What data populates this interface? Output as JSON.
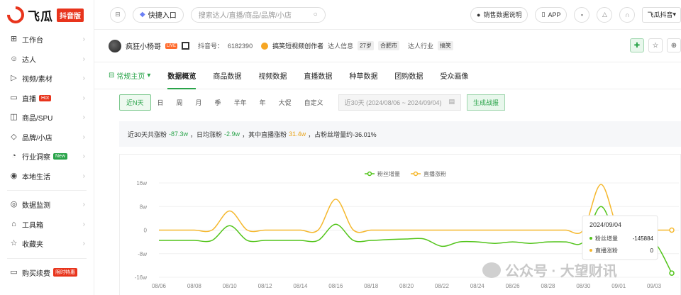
{
  "brand": {
    "name": "飞瓜",
    "badge": "抖音版"
  },
  "sidebar": {
    "items": [
      {
        "icon": "dashboard-icon",
        "glyph": "⊞",
        "label": "工作台"
      },
      {
        "icon": "user-icon",
        "glyph": "☺",
        "label": "达人"
      },
      {
        "icon": "play-icon",
        "glyph": "▷",
        "label": "视频/素材"
      },
      {
        "icon": "live-icon",
        "glyph": "▭",
        "label": "直播",
        "tag": "Hot",
        "tag_color": "#e8341c"
      },
      {
        "icon": "bag-icon",
        "glyph": "◫",
        "label": "商品/SPU"
      },
      {
        "icon": "tag-icon",
        "glyph": "◇",
        "label": "品牌/小店"
      },
      {
        "icon": "industry-icon",
        "glyph": "◔",
        "label": "行业洞察",
        "tag": "New",
        "tag_color": "#2aa44a"
      },
      {
        "icon": "location-icon",
        "glyph": "◉",
        "label": "本地生活"
      }
    ],
    "items2": [
      {
        "icon": "monitor-icon",
        "glyph": "◎",
        "label": "数据监测"
      },
      {
        "icon": "toolbox-icon",
        "glyph": "⌂",
        "label": "工具箱"
      },
      {
        "icon": "star-icon",
        "glyph": "☆",
        "label": "收藏夹"
      }
    ],
    "bottom": {
      "label": "购买续费",
      "tag": "限时特惠"
    }
  },
  "topbar": {
    "quick_entry": "快捷入口",
    "search_placeholder": "搜索达人/直播/商品/品牌/小店",
    "sales_note": "销售数据说明",
    "app": "APP",
    "user": "飞瓜抖音"
  },
  "profile": {
    "name": "疯狂小杨哥",
    "live_tag": "LIVE",
    "douyin_id_label": "抖音号：",
    "douyin_id": "6182390",
    "creator_label": "搞笑短视频创作者",
    "info_label": "达人信息",
    "age": "27岁",
    "city": "合肥市",
    "industry_label": "达人行业",
    "industry": "搞笑"
  },
  "tabs": [
    {
      "label": "常规主页",
      "first": true
    },
    {
      "label": "数据概览",
      "active": true
    },
    {
      "label": "商品数据"
    },
    {
      "label": "视频数据"
    },
    {
      "label": "直播数据"
    },
    {
      "label": "种草数据"
    },
    {
      "label": "团购数据"
    },
    {
      "label": "受众画像"
    }
  ],
  "filters": {
    "options": [
      "近N天",
      "日",
      "周",
      "月",
      "季",
      "半年",
      "年",
      "大促",
      "自定义"
    ],
    "active_index": 0,
    "date_range": "近30天 (2024/08/06 ~ 2024/09/04)",
    "generate": "生成战报"
  },
  "summary": {
    "t1": "近30天共涨粉",
    "v1": "-87.3w",
    "t2": "，日均涨粉",
    "v2": "-2.9w",
    "t3": "，其中直播涨粉",
    "v3": "31.4w",
    "t4": "，占粉丝增量约-36.01%"
  },
  "chart_data": {
    "type": "line",
    "x": [
      "08/06",
      "08/07",
      "08/08",
      "08/09",
      "08/10",
      "08/11",
      "08/12",
      "08/13",
      "08/14",
      "08/15",
      "08/16",
      "08/17",
      "08/18",
      "08/19",
      "08/20",
      "08/21",
      "08/22",
      "08/23",
      "08/24",
      "08/25",
      "08/26",
      "08/27",
      "08/28",
      "08/29",
      "08/30",
      "08/31",
      "09/01",
      "09/02",
      "09/03",
      "09/04"
    ],
    "tick_labels": [
      "08/06",
      "08/08",
      "08/10",
      "08/12",
      "08/14",
      "08/16",
      "08/18",
      "08/20",
      "08/22",
      "08/24",
      "08/26",
      "08/28",
      "08/30",
      "09/01",
      "09/03"
    ],
    "yticks": [
      "16w",
      "8w",
      "0",
      "-8w",
      "-16w"
    ],
    "ylim": [
      -16,
      16
    ],
    "series": [
      {
        "name": "粉丝增量",
        "color": "#52c41a",
        "values": [
          -3.5,
          -3.5,
          -3.5,
          -3.5,
          1.5,
          -3.5,
          -3.5,
          -3.5,
          -3.5,
          -3.5,
          2,
          -3.5,
          -3.5,
          -3.2,
          -3,
          -3,
          -5.5,
          -4,
          -4,
          -4.5,
          -4,
          -4.5,
          -4,
          -4,
          -4,
          8,
          -4,
          -4,
          -4,
          -14.6
        ]
      },
      {
        "name": "直播涨粉",
        "color": "#f5b82e",
        "values": [
          0,
          0,
          0,
          0,
          6.5,
          0,
          0,
          0,
          0,
          0,
          10.5,
          0,
          0,
          0,
          0,
          0,
          0,
          0,
          0,
          0,
          0,
          0,
          0,
          0,
          0,
          15.5,
          0,
          0,
          0,
          0
        ]
      }
    ],
    "legend": "top-center",
    "tooltip": {
      "date": "2024/09/04",
      "rows": [
        {
          "name": "粉丝增量",
          "value": "-145884",
          "color": "#52c41a"
        },
        {
          "name": "直播涨粉",
          "value": "0",
          "color": "#f5b82e"
        }
      ]
    }
  },
  "watermark": "公众号 · 大望财讯"
}
